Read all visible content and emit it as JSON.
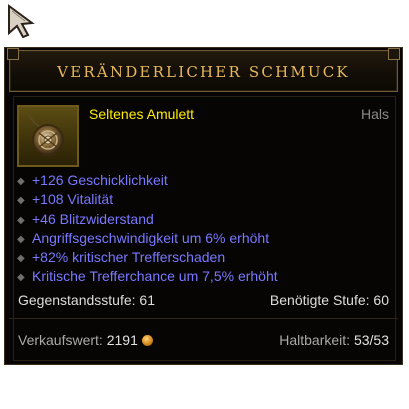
{
  "header": {
    "title": "VERÄNDERLICHER SCHMUCK"
  },
  "item": {
    "icon": "amulet-icon",
    "rarity_type": "Seltenes Amulett",
    "slot": "Hals"
  },
  "properties": [
    "+126 Geschicklichkeit",
    "+108 Vitalität",
    "+46 Blitzwiderstand",
    "Angriffsgeschwindigkeit um 6% erhöht",
    "+82% kritischer Trefferschaden",
    "Kritische Trefferchance um 7,5% erhöht"
  ],
  "requirements": {
    "item_level": "Gegenstandsstufe: 61",
    "required_level": "Benötigte Stufe: 60"
  },
  "footer": {
    "sell_label": "Verkaufswert:",
    "sell_value": "2191",
    "durability_label": "Haltbarkeit:",
    "durability_value": "53/53"
  },
  "colors": {
    "title": "#e7b85a",
    "rarity": "#ffee00",
    "magic_property": "#7a78ff",
    "background": "#060504"
  }
}
